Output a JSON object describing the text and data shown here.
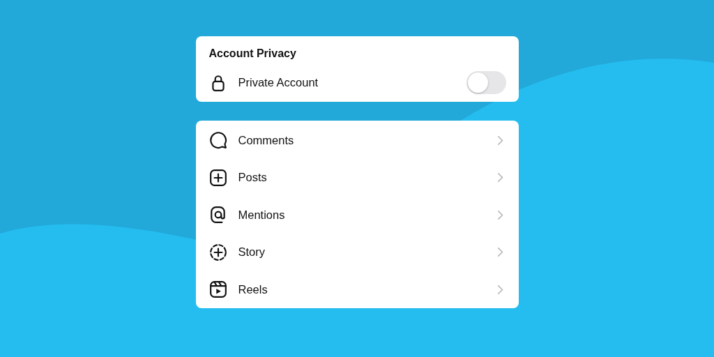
{
  "privacy": {
    "title": "Account Privacy",
    "setting": {
      "label": "Private Account",
      "on": false
    }
  },
  "menu": [
    {
      "label": "Comments",
      "kind": "comment"
    },
    {
      "label": "Posts",
      "kind": "post"
    },
    {
      "label": "Mentions",
      "kind": "mention"
    },
    {
      "label": "Story",
      "kind": "story"
    },
    {
      "label": "Reels",
      "kind": "reel"
    }
  ]
}
